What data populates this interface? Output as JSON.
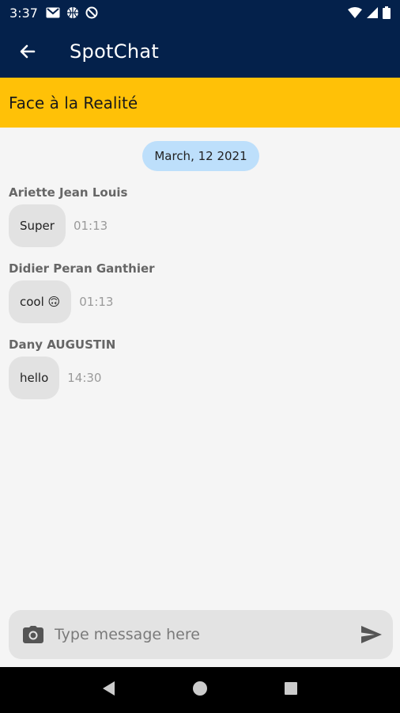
{
  "status_bar": {
    "time": "3:37"
  },
  "app_bar": {
    "title": "SpotChat"
  },
  "group": {
    "name": "Face à la Realité"
  },
  "chat": {
    "date": "March, 12 2021",
    "messages": [
      {
        "sender": "Ariette Jean Louis",
        "text": "Super",
        "time": "01:13"
      },
      {
        "sender": "Didier Peran Ganthier",
        "text": "cool 🙃",
        "time": "01:13"
      },
      {
        "sender": "Dany AUGUSTIN",
        "text": "hello",
        "time": "14:30"
      }
    ]
  },
  "composer": {
    "placeholder": "Type message here"
  },
  "icons": {
    "back": "arrow-left-icon",
    "camera": "camera-icon",
    "send": "send-icon",
    "nav_back": "triangle-back-icon",
    "nav_home": "circle-home-icon",
    "nav_recent": "square-recent-icon"
  },
  "colors": {
    "primary": "#04214b",
    "accent": "#ffc107",
    "date_pill": "#bddffb",
    "bubble": "#e2e2e2"
  }
}
